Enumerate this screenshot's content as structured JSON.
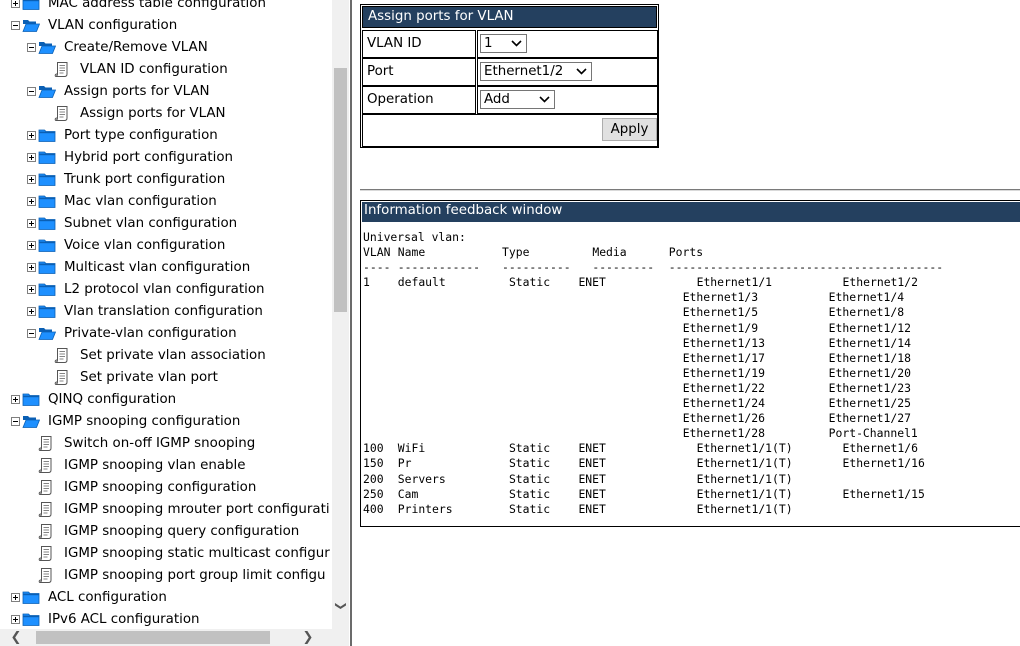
{
  "tree": [
    {
      "label": "MAC address table configuration",
      "level": 0,
      "type": "folder",
      "expander": "plus",
      "open": false
    },
    {
      "label": "VLAN configuration",
      "level": 0,
      "type": "folder",
      "expander": "minus",
      "open": true
    },
    {
      "label": "Create/Remove VLAN",
      "level": 1,
      "type": "folder",
      "expander": "minus",
      "open": true
    },
    {
      "label": "VLAN ID configuration",
      "level": 2,
      "type": "leaf"
    },
    {
      "label": "Assign ports for VLAN",
      "level": 1,
      "type": "folder",
      "expander": "minus",
      "open": true
    },
    {
      "label": "Assign ports for VLAN",
      "level": 2,
      "type": "leaf"
    },
    {
      "label": "Port type configuration",
      "level": 1,
      "type": "folder",
      "expander": "plus",
      "open": false
    },
    {
      "label": "Hybrid port configuration",
      "level": 1,
      "type": "folder",
      "expander": "plus",
      "open": false
    },
    {
      "label": "Trunk port configuration",
      "level": 1,
      "type": "folder",
      "expander": "plus",
      "open": false
    },
    {
      "label": "Mac vlan configuration",
      "level": 1,
      "type": "folder",
      "expander": "plus",
      "open": false
    },
    {
      "label": "Subnet vlan configuration",
      "level": 1,
      "type": "folder",
      "expander": "plus",
      "open": false
    },
    {
      "label": "Voice vlan configuration",
      "level": 1,
      "type": "folder",
      "expander": "plus",
      "open": false
    },
    {
      "label": "Multicast vlan configuration",
      "level": 1,
      "type": "folder",
      "expander": "plus",
      "open": false
    },
    {
      "label": "L2 protocol vlan configuration",
      "level": 1,
      "type": "folder",
      "expander": "plus",
      "open": false
    },
    {
      "label": "Vlan translation configuration",
      "level": 1,
      "type": "folder",
      "expander": "plus",
      "open": false
    },
    {
      "label": "Private-vlan configuration",
      "level": 1,
      "type": "folder",
      "expander": "minus",
      "open": true
    },
    {
      "label": "Set private vlan association",
      "level": 2,
      "type": "leaf"
    },
    {
      "label": "Set private vlan port",
      "level": 2,
      "type": "leaf"
    },
    {
      "label": "QINQ configuration",
      "level": 0,
      "type": "folder",
      "expander": "plus",
      "open": false
    },
    {
      "label": "IGMP snooping configuration",
      "level": 0,
      "type": "folder",
      "expander": "minus",
      "open": true
    },
    {
      "label": "Switch on-off IGMP snooping",
      "level": 1,
      "type": "leaf"
    },
    {
      "label": "IGMP snooping vlan enable",
      "level": 1,
      "type": "leaf"
    },
    {
      "label": "IGMP snooping configuration",
      "level": 1,
      "type": "leaf"
    },
    {
      "label": "IGMP snooping mrouter port configurati",
      "level": 1,
      "type": "leaf"
    },
    {
      "label": "IGMP snooping query configuration",
      "level": 1,
      "type": "leaf"
    },
    {
      "label": "IGMP snooping static multicast configur",
      "level": 1,
      "type": "leaf"
    },
    {
      "label": "IGMP snooping port group limit configu",
      "level": 1,
      "type": "leaf"
    },
    {
      "label": "ACL configuration",
      "level": 0,
      "type": "folder",
      "expander": "plus",
      "open": false
    },
    {
      "label": "IPv6 ACL configuration",
      "level": 0,
      "type": "folder",
      "expander": "plus",
      "open": false
    }
  ],
  "scroll": {
    "up": "",
    "down": "❯",
    "left": "❮",
    "right": "❯"
  },
  "form": {
    "title": "Assign ports for VLAN",
    "vlan_id_label": "VLAN ID",
    "vlan_id_value": "1",
    "port_label": "Port",
    "port_value": "Ethernet1/2",
    "operation_label": "Operation",
    "operation_value": "Add",
    "apply_label": "Apply"
  },
  "info": {
    "title": "Information feedback window",
    "heading": "Universal vlan:",
    "columns": [
      "VLAN",
      "Name",
      "Type",
      "Media",
      "Ports"
    ],
    "separator_segments": [
      "----",
      "------------",
      "----------",
      "---------",
      "----------------------------------------"
    ],
    "rows": [
      {
        "vlan": "1",
        "name": "default",
        "type": "Static",
        "media": "ENET",
        "ports": [
          "Ethernet1/1",
          "Ethernet1/2",
          "Ethernet1/3",
          "Ethernet1/4",
          "Ethernet1/5",
          "Ethernet1/8",
          "Ethernet1/9",
          "Ethernet1/12",
          "Ethernet1/13",
          "Ethernet1/14",
          "Ethernet1/17",
          "Ethernet1/18",
          "Ethernet1/19",
          "Ethernet1/20",
          "Ethernet1/22",
          "Ethernet1/23",
          "Ethernet1/24",
          "Ethernet1/25",
          "Ethernet1/26",
          "Ethernet1/27",
          "Ethernet1/28",
          "Port-Channel1"
        ]
      },
      {
        "vlan": "100",
        "name": "WiFi",
        "type": "Static",
        "media": "ENET",
        "ports": [
          "Ethernet1/1(T)",
          "Ethernet1/6"
        ]
      },
      {
        "vlan": "150",
        "name": "Pr",
        "type": "Static",
        "media": "ENET",
        "ports": [
          "Ethernet1/1(T)",
          "Ethernet1/16"
        ]
      },
      {
        "vlan": "200",
        "name": "Servers",
        "type": "Static",
        "media": "ENET",
        "ports": [
          "Ethernet1/1(T)"
        ]
      },
      {
        "vlan": "250",
        "name": "Cam",
        "type": "Static",
        "media": "ENET",
        "ports": [
          "Ethernet1/1(T)",
          "Ethernet1/15"
        ]
      },
      {
        "vlan": "400",
        "name": "Printers",
        "type": "Static",
        "media": "ENET",
        "ports": [
          "Ethernet1/1(T)"
        ]
      }
    ]
  },
  "colors": {
    "header_bg": "#24405f",
    "folder": "#1e90ff",
    "folder_dark": "#0a5fb4"
  }
}
